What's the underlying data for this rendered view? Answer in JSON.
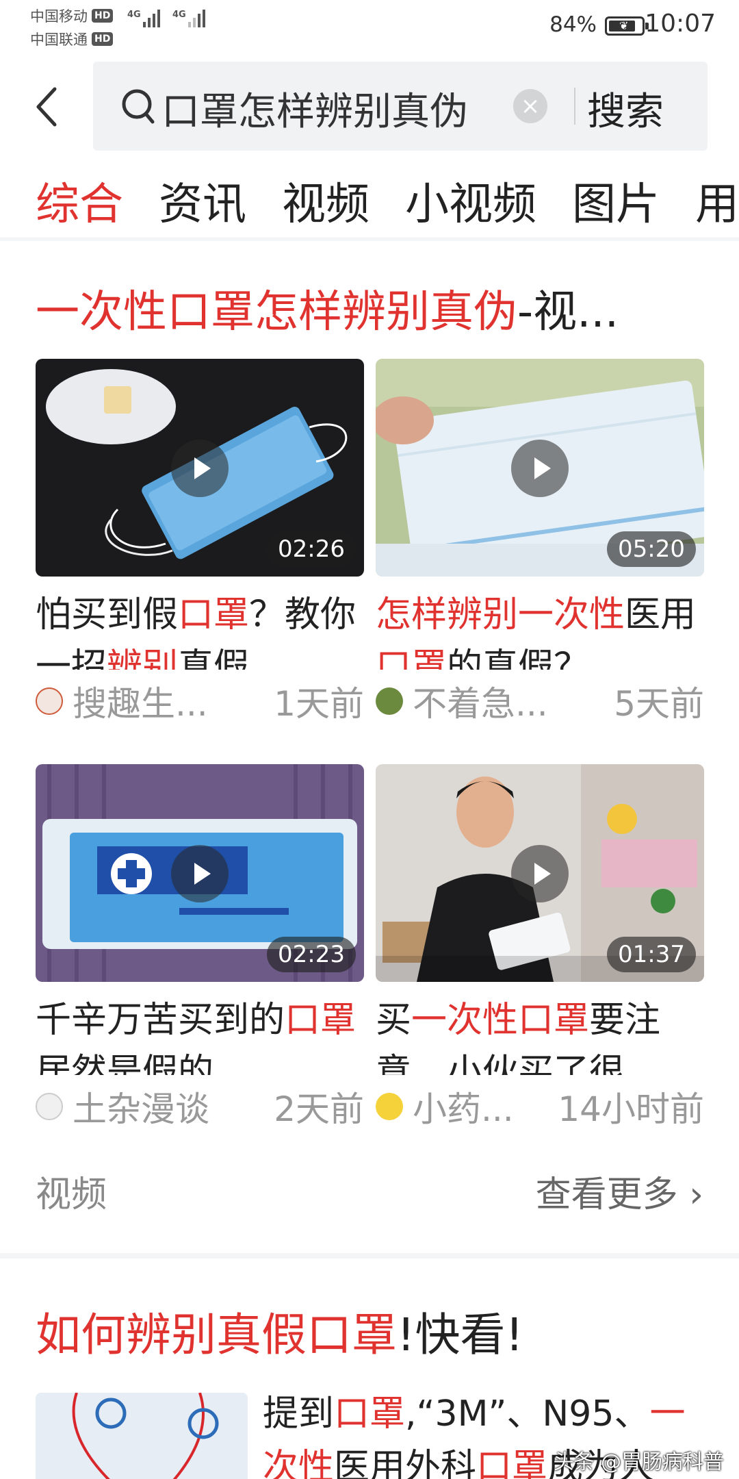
{
  "status": {
    "carrier1": "中国移动",
    "carrier2": "中国联通",
    "hd": "HD",
    "net": "4G",
    "battery": "84%",
    "battery_level": 0.84,
    "time": "10:07"
  },
  "search": {
    "query_visible": "口罩怎样辨别真伪",
    "button": "搜索"
  },
  "tabs": [
    "综合",
    "资讯",
    "视频",
    "小视频",
    "图片",
    "用户"
  ],
  "active_tab": 0,
  "video_card": {
    "title_red": "一次性口罩怎样辨别真伪",
    "title_rest": "-视...",
    "footer_label": "视频",
    "more_label": "查看更多",
    "items": [
      {
        "duration": "02:26",
        "title_parts": [
          {
            "t": "怕买到假",
            "red": false
          },
          {
            "t": "口罩",
            "red": true
          },
          {
            "t": "？教你一招",
            "red": false
          },
          {
            "t": "辨别",
            "red": true
          },
          {
            "t": "真假",
            "red": false
          }
        ],
        "author": "搜趣生...",
        "time": "1天前"
      },
      {
        "duration": "05:20",
        "title_parts": [
          {
            "t": "怎样辨别一次性",
            "red": true
          },
          {
            "t": "医用",
            "red": false
          },
          {
            "t": "口罩",
            "red": true
          },
          {
            "t": "的真假？",
            "red": false
          }
        ],
        "author": "不着急...",
        "time": "5天前"
      },
      {
        "duration": "02:23",
        "title_parts": [
          {
            "t": "千辛万苦买到的",
            "red": false
          },
          {
            "t": "口罩",
            "red": true
          },
          {
            "t": "居然是假的，",
            "red": false
          }
        ],
        "author": "土杂漫谈",
        "time": "2天前"
      },
      {
        "duration": "01:37",
        "title_parts": [
          {
            "t": "买",
            "red": false
          },
          {
            "t": "一次性口罩",
            "red": true
          },
          {
            "t": "要注意，小伙买了很",
            "red": false
          }
        ],
        "author": "小药...",
        "time": "14小时前"
      }
    ]
  },
  "article_card": {
    "title_red": "如何辨别真假口罩",
    "title_rest": "!快看!",
    "text_parts": [
      {
        "t": "提到",
        "red": false
      },
      {
        "t": "口罩",
        "red": true
      },
      {
        "t": ",“3M”、N95、",
        "red": false
      },
      {
        "t": "一次性",
        "red": true
      },
      {
        "t": "医用外科",
        "red": false
      },
      {
        "t": "口罩",
        "red": true
      },
      {
        "t": "成为人",
        "red": false
      }
    ]
  },
  "watermark": "头条 @胃肠病科普",
  "colors": {
    "accent": "#e0332f",
    "muted": "#999999"
  }
}
